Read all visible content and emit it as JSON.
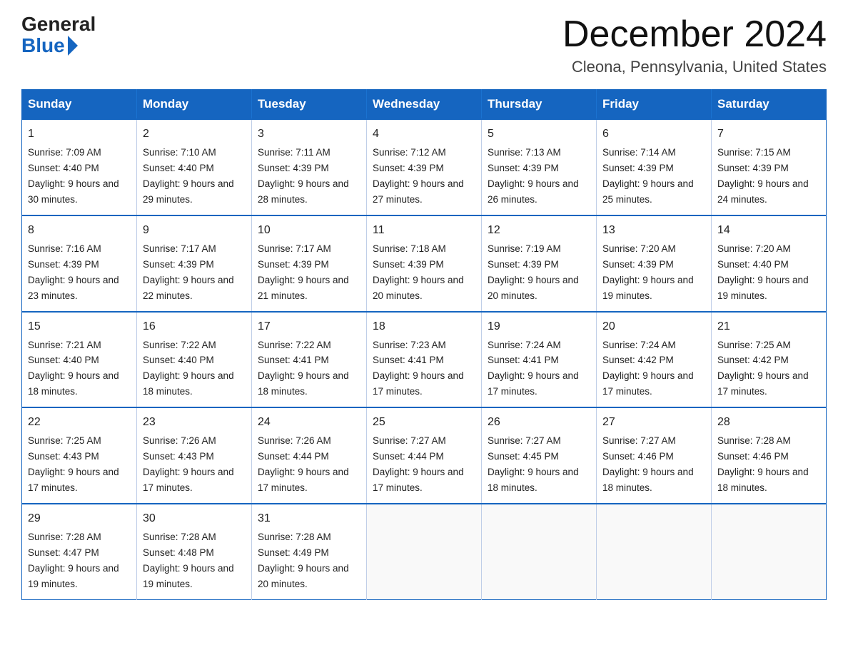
{
  "logo": {
    "general": "General",
    "blue": "Blue"
  },
  "header": {
    "month_year": "December 2024",
    "location": "Cleona, Pennsylvania, United States"
  },
  "weekdays": [
    "Sunday",
    "Monday",
    "Tuesday",
    "Wednesday",
    "Thursday",
    "Friday",
    "Saturday"
  ],
  "weeks": [
    [
      {
        "day": 1,
        "sunrise": "7:09 AM",
        "sunset": "4:40 PM",
        "daylight": "9 hours and 30 minutes."
      },
      {
        "day": 2,
        "sunrise": "7:10 AM",
        "sunset": "4:40 PM",
        "daylight": "9 hours and 29 minutes."
      },
      {
        "day": 3,
        "sunrise": "7:11 AM",
        "sunset": "4:39 PM",
        "daylight": "9 hours and 28 minutes."
      },
      {
        "day": 4,
        "sunrise": "7:12 AM",
        "sunset": "4:39 PM",
        "daylight": "9 hours and 27 minutes."
      },
      {
        "day": 5,
        "sunrise": "7:13 AM",
        "sunset": "4:39 PM",
        "daylight": "9 hours and 26 minutes."
      },
      {
        "day": 6,
        "sunrise": "7:14 AM",
        "sunset": "4:39 PM",
        "daylight": "9 hours and 25 minutes."
      },
      {
        "day": 7,
        "sunrise": "7:15 AM",
        "sunset": "4:39 PM",
        "daylight": "9 hours and 24 minutes."
      }
    ],
    [
      {
        "day": 8,
        "sunrise": "7:16 AM",
        "sunset": "4:39 PM",
        "daylight": "9 hours and 23 minutes."
      },
      {
        "day": 9,
        "sunrise": "7:17 AM",
        "sunset": "4:39 PM",
        "daylight": "9 hours and 22 minutes."
      },
      {
        "day": 10,
        "sunrise": "7:17 AM",
        "sunset": "4:39 PM",
        "daylight": "9 hours and 21 minutes."
      },
      {
        "day": 11,
        "sunrise": "7:18 AM",
        "sunset": "4:39 PM",
        "daylight": "9 hours and 20 minutes."
      },
      {
        "day": 12,
        "sunrise": "7:19 AM",
        "sunset": "4:39 PM",
        "daylight": "9 hours and 20 minutes."
      },
      {
        "day": 13,
        "sunrise": "7:20 AM",
        "sunset": "4:39 PM",
        "daylight": "9 hours and 19 minutes."
      },
      {
        "day": 14,
        "sunrise": "7:20 AM",
        "sunset": "4:40 PM",
        "daylight": "9 hours and 19 minutes."
      }
    ],
    [
      {
        "day": 15,
        "sunrise": "7:21 AM",
        "sunset": "4:40 PM",
        "daylight": "9 hours and 18 minutes."
      },
      {
        "day": 16,
        "sunrise": "7:22 AM",
        "sunset": "4:40 PM",
        "daylight": "9 hours and 18 minutes."
      },
      {
        "day": 17,
        "sunrise": "7:22 AM",
        "sunset": "4:41 PM",
        "daylight": "9 hours and 18 minutes."
      },
      {
        "day": 18,
        "sunrise": "7:23 AM",
        "sunset": "4:41 PM",
        "daylight": "9 hours and 17 minutes."
      },
      {
        "day": 19,
        "sunrise": "7:24 AM",
        "sunset": "4:41 PM",
        "daylight": "9 hours and 17 minutes."
      },
      {
        "day": 20,
        "sunrise": "7:24 AM",
        "sunset": "4:42 PM",
        "daylight": "9 hours and 17 minutes."
      },
      {
        "day": 21,
        "sunrise": "7:25 AM",
        "sunset": "4:42 PM",
        "daylight": "9 hours and 17 minutes."
      }
    ],
    [
      {
        "day": 22,
        "sunrise": "7:25 AM",
        "sunset": "4:43 PM",
        "daylight": "9 hours and 17 minutes."
      },
      {
        "day": 23,
        "sunrise": "7:26 AM",
        "sunset": "4:43 PM",
        "daylight": "9 hours and 17 minutes."
      },
      {
        "day": 24,
        "sunrise": "7:26 AM",
        "sunset": "4:44 PM",
        "daylight": "9 hours and 17 minutes."
      },
      {
        "day": 25,
        "sunrise": "7:27 AM",
        "sunset": "4:44 PM",
        "daylight": "9 hours and 17 minutes."
      },
      {
        "day": 26,
        "sunrise": "7:27 AM",
        "sunset": "4:45 PM",
        "daylight": "9 hours and 18 minutes."
      },
      {
        "day": 27,
        "sunrise": "7:27 AM",
        "sunset": "4:46 PM",
        "daylight": "9 hours and 18 minutes."
      },
      {
        "day": 28,
        "sunrise": "7:28 AM",
        "sunset": "4:46 PM",
        "daylight": "9 hours and 18 minutes."
      }
    ],
    [
      {
        "day": 29,
        "sunrise": "7:28 AM",
        "sunset": "4:47 PM",
        "daylight": "9 hours and 19 minutes."
      },
      {
        "day": 30,
        "sunrise": "7:28 AM",
        "sunset": "4:48 PM",
        "daylight": "9 hours and 19 minutes."
      },
      {
        "day": 31,
        "sunrise": "7:28 AM",
        "sunset": "4:49 PM",
        "daylight": "9 hours and 20 minutes."
      },
      null,
      null,
      null,
      null
    ]
  ]
}
